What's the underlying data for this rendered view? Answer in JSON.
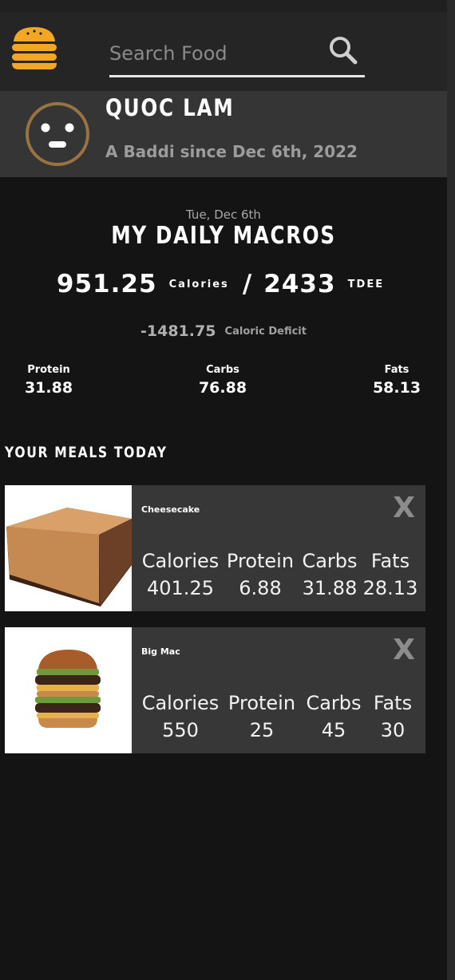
{
  "header": {
    "logo_icon": "burger-icon",
    "search_placeholder": "Search Food",
    "search_value": "",
    "search_icon": "magnifier-icon"
  },
  "profile": {
    "avatar_icon": "neutral-face-icon",
    "name": "Quoc Lam",
    "member_since": "A Baddi since Dec 6th, 2022"
  },
  "daily": {
    "date": "Tue, Dec 6th",
    "title": "My Daily Macros",
    "calories": "951.25",
    "calories_label": "Calories",
    "separator": "/",
    "tdee": "2433",
    "tdee_label": "TDEE",
    "deficit_value": "-1481.75",
    "deficit_label": "Caloric Deficit",
    "macros": [
      {
        "label": "Protein",
        "value": "31.88"
      },
      {
        "label": "Carbs",
        "value": "76.88"
      },
      {
        "label": "Fats",
        "value": "58.13"
      }
    ]
  },
  "meals_section": {
    "title": "Your Meals Today",
    "remove_label": "X",
    "stat_labels": [
      "Calories",
      "Protein",
      "Carbs",
      "Fats"
    ],
    "items": [
      {
        "name": "Cheesecake",
        "image": "cheesecake-photo",
        "stats": [
          "401.25",
          "6.88",
          "31.88",
          "28.13"
        ]
      },
      {
        "name": "Big Mac",
        "image": "big-mac-photo",
        "stats": [
          "550",
          "25",
          "45",
          "30"
        ]
      }
    ]
  },
  "colors": {
    "background": "#141414",
    "navbar": "#252525",
    "profile_bar": "#353535",
    "card": "#373737",
    "accent": "#f5a623",
    "avatar_ring": "#9a7440"
  }
}
